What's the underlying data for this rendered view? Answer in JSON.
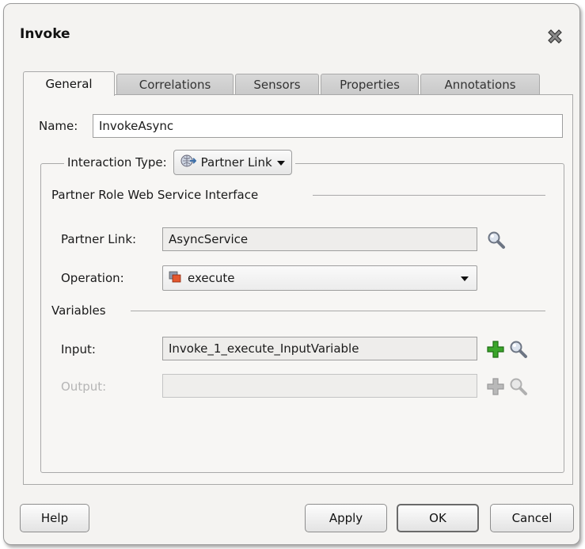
{
  "dialog": {
    "title": "Invoke"
  },
  "tabs": [
    {
      "label": "General",
      "active": true
    },
    {
      "label": "Correlations"
    },
    {
      "label": "Sensors"
    },
    {
      "label": "Properties"
    },
    {
      "label": "Annotations"
    }
  ],
  "name": {
    "label": "Name:",
    "value": "InvokeAsync"
  },
  "interaction": {
    "label": "Interaction Type:",
    "value": "Partner Link"
  },
  "partner_role": {
    "section_label": "Partner Role Web Service Interface"
  },
  "partner_link": {
    "label": "Partner Link:",
    "value": "AsyncService"
  },
  "operation": {
    "label": "Operation:",
    "value": "execute"
  },
  "variables": {
    "section_label": "Variables",
    "input_label": "Input:",
    "input_value": "Invoke_1_execute_InputVariable",
    "output_label": "Output:",
    "output_value": ""
  },
  "buttons": {
    "help": "Help",
    "apply": "Apply",
    "ok": "OK",
    "cancel": "Cancel"
  },
  "icons": {
    "close": "close-x-icon",
    "interaction": "partner-link-icon",
    "operation": "operation-icon",
    "search": "magnifier-icon",
    "add": "plus-icon"
  },
  "colors": {
    "add_green": "#3aa52a",
    "add_disabled": "#b9b9b9"
  }
}
